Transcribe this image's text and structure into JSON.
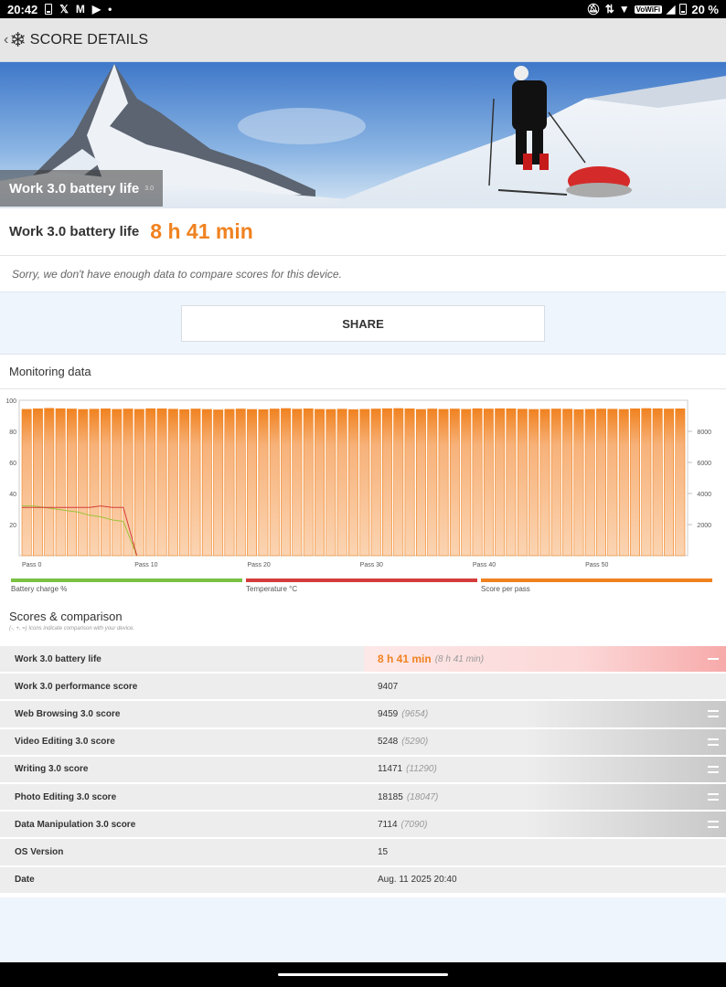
{
  "status_bar": {
    "time": "20:42",
    "left_icons": [
      "battery-saver-icon",
      "x-icon",
      "gmail-icon",
      "youtube-icon",
      "dot-icon"
    ],
    "right_icons": [
      "mute-icon",
      "data-arrows-icon",
      "wifi-icon",
      "vowifi-icon",
      "signal-icon",
      "battery-icon"
    ],
    "vowifi_label": "VoWiFi",
    "battery_level": "20 %"
  },
  "app_bar": {
    "back_icon": "back-chevron-icon",
    "logo_icon": "snowflake-icon",
    "title": "SCORE DETAILS"
  },
  "hero": {
    "title": "Work 3.0 battery life",
    "version": "3.0"
  },
  "result": {
    "label": "Work 3.0 battery life",
    "value": "8 h 41 min",
    "note": "Sorry, we don't have enough data to compare scores for this device."
  },
  "share_label": "SHARE",
  "monitoring": {
    "title": "Monitoring data",
    "legend": [
      {
        "label": "Battery charge %",
        "color": "#7ac143"
      },
      {
        "label": "Temperature °C",
        "color": "#d53b3b"
      },
      {
        "label": "Score per pass",
        "color": "#f08220"
      }
    ]
  },
  "chart_data": {
    "type": "bar",
    "left_axis_ticks": [
      "100",
      "80",
      "60",
      "40",
      "20"
    ],
    "right_axis_ticks": [
      "8000",
      "6000",
      "4000",
      "2000"
    ],
    "x_tick_labels": [
      "Pass 0",
      "Pass 10",
      "Pass 20",
      "Pass 30",
      "Pass 40",
      "Pass 50"
    ],
    "left_ylim": [
      0,
      100
    ],
    "right_ylim": [
      0,
      10000
    ],
    "bar_series": {
      "name": "Score per pass",
      "values": [
        9420,
        9450,
        9480,
        9460,
        9440,
        9410,
        9430,
        9450,
        9420,
        9440,
        9420,
        9460,
        9450,
        9430,
        9400,
        9440,
        9410,
        9380,
        9420,
        9440,
        9410,
        9400,
        9440,
        9470,
        9430,
        9450,
        9420,
        9410,
        9430,
        9400,
        9420,
        9440,
        9460,
        9470,
        9450,
        9410,
        9440,
        9420,
        9440,
        9420,
        9460,
        9440,
        9460,
        9450,
        9430,
        9410,
        9420,
        9440,
        9430,
        9400,
        9420,
        9440,
        9430,
        9410,
        9450,
        9470,
        9460,
        9440,
        9450
      ]
    },
    "line_series": [
      {
        "name": "Battery charge %",
        "x": [
          0,
          1,
          2,
          3,
          4,
          5,
          6,
          7,
          8,
          9,
          10
        ],
        "y": [
          32,
          32,
          31,
          30,
          29,
          28,
          26,
          25,
          23,
          22,
          0
        ]
      },
      {
        "name": "Temperature °C",
        "x": [
          0,
          1,
          2,
          3,
          4,
          5,
          6,
          7,
          8,
          9,
          10
        ],
        "y": [
          31,
          31,
          31,
          31,
          31,
          31,
          31,
          32,
          31,
          31,
          0
        ]
      }
    ]
  },
  "scores": {
    "title": "Scores & comparison",
    "hint": "(-, +, =) Icons indicate comparison with your device.",
    "rows": [
      {
        "label": "Work 3.0 battery life",
        "value": "8 h 41 min",
        "compare": "(8 h 41 min)",
        "style": "highlight",
        "icon": "minus-icon"
      },
      {
        "label": "Work 3.0 performance score",
        "value": "9407",
        "compare": "",
        "style": "plain",
        "icon": ""
      },
      {
        "label": "Web Browsing 3.0 score",
        "value": "9459",
        "compare": "(9654)",
        "style": "grad",
        "icon": "equal-icon"
      },
      {
        "label": "Video Editing 3.0 score",
        "value": "5248",
        "compare": "(5290)",
        "style": "grad",
        "icon": "equal-icon"
      },
      {
        "label": "Writing 3.0 score",
        "value": "11471",
        "compare": "(11290)",
        "style": "grad",
        "icon": "equal-icon"
      },
      {
        "label": "Photo Editing 3.0 score",
        "value": "18185",
        "compare": "(18047)",
        "style": "grad",
        "icon": "equal-icon"
      },
      {
        "label": "Data Manipulation 3.0 score",
        "value": "7114",
        "compare": "(7090)",
        "style": "grad",
        "icon": "equal-icon"
      },
      {
        "label": "OS Version",
        "value": "15",
        "compare": "",
        "style": "plain",
        "icon": ""
      },
      {
        "label": "Date",
        "value": "Aug. 11 2025 20:40",
        "compare": "",
        "style": "plain",
        "icon": ""
      }
    ]
  }
}
